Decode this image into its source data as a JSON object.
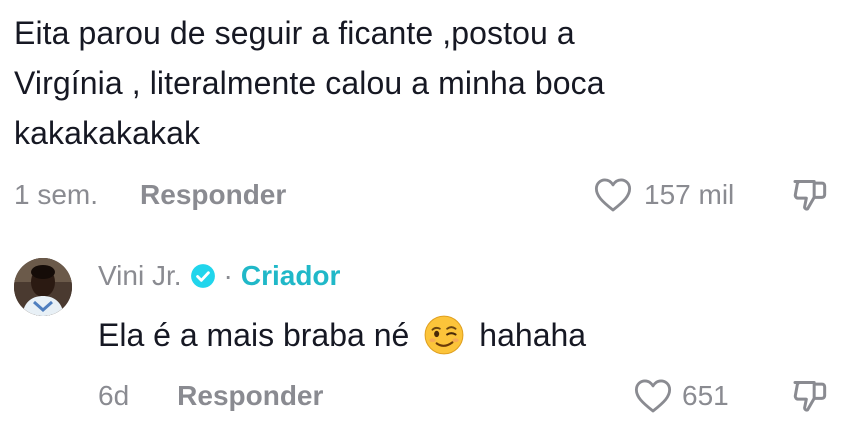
{
  "top_comment": {
    "text": "Eita parou de seguir a ficante ,postou a\nVirgínia , literalmente calou a minha boca\nkakakakakak",
    "time": "1 sem.",
    "reply_label": "Responder",
    "like_count": "157 mil"
  },
  "reply": {
    "author": "Vini Jr.",
    "separator": "·",
    "creator_label": "Criador",
    "text_before_emoji": "Ela é a mais braba né",
    "emoji": "winking-face-emoji",
    "text_after_emoji": "hahaha",
    "time": "6d",
    "reply_label": "Responder",
    "like_count": "651"
  },
  "colors": {
    "text": "#161823",
    "muted": "#8a8b91",
    "creator": "#20b8c8",
    "verified": "#20d5ec"
  },
  "icons": {
    "like": "heart-outline-icon",
    "dislike": "thumbs-down-outline-icon",
    "verified": "verified-badge-icon"
  }
}
